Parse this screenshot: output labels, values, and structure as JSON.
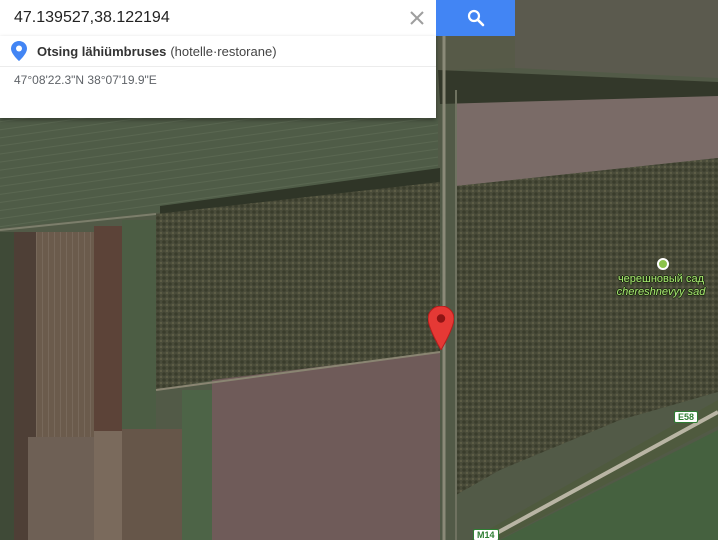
{
  "search": {
    "query": "47.139527,38.122194",
    "clear_icon": "close-icon",
    "submit_icon": "search-icon",
    "accent_color": "#4285f4"
  },
  "suggestions": {
    "nearby": {
      "icon": "place-pin-icon",
      "label": "Otsing lähiümbruses",
      "extra": "(hotelle·restorane)"
    },
    "coordinates_dms": "47°08'22.3\"N 38°07'19.9\"E"
  },
  "map": {
    "type": "satellite",
    "marker": {
      "icon": "red-map-pin-icon",
      "color": "#e53935"
    },
    "poi": {
      "name": "черешновый сад",
      "transliteration": "chereshnevyy sad",
      "icon": "park-dot-icon"
    },
    "road_shields": [
      "E58",
      "M14"
    ]
  }
}
